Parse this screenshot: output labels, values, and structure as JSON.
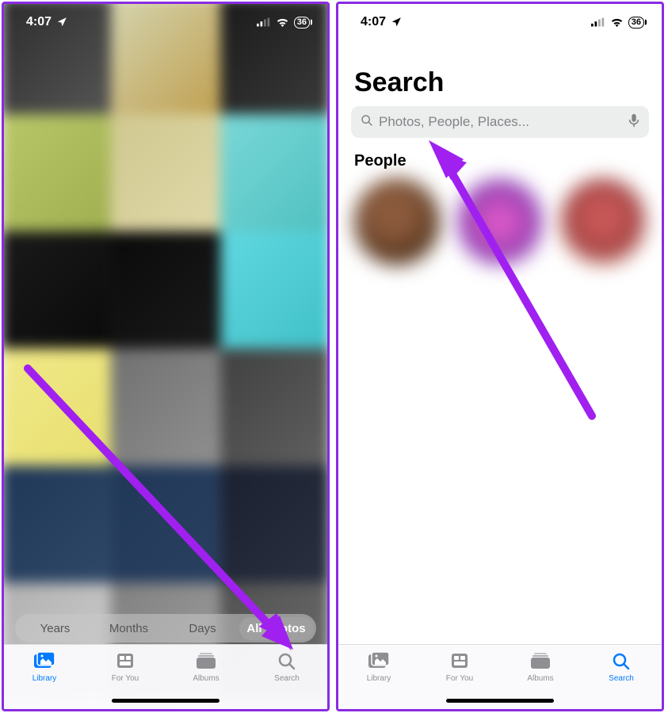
{
  "status": {
    "time": "4:07",
    "battery": "36"
  },
  "left": {
    "seg": {
      "years": "Years",
      "months": "Months",
      "days": "Days",
      "all": "All Photos"
    },
    "tabs": {
      "library": "Library",
      "foryou": "For You",
      "albums": "Albums",
      "search": "Search"
    }
  },
  "right": {
    "title": "Search",
    "search_placeholder": "Photos, People, Places...",
    "people_heading": "People",
    "tabs": {
      "library": "Library",
      "foryou": "For You",
      "albums": "Albums",
      "search": "Search"
    }
  },
  "colors": {
    "accent": "#007aff",
    "annotation": "#a020f0"
  }
}
